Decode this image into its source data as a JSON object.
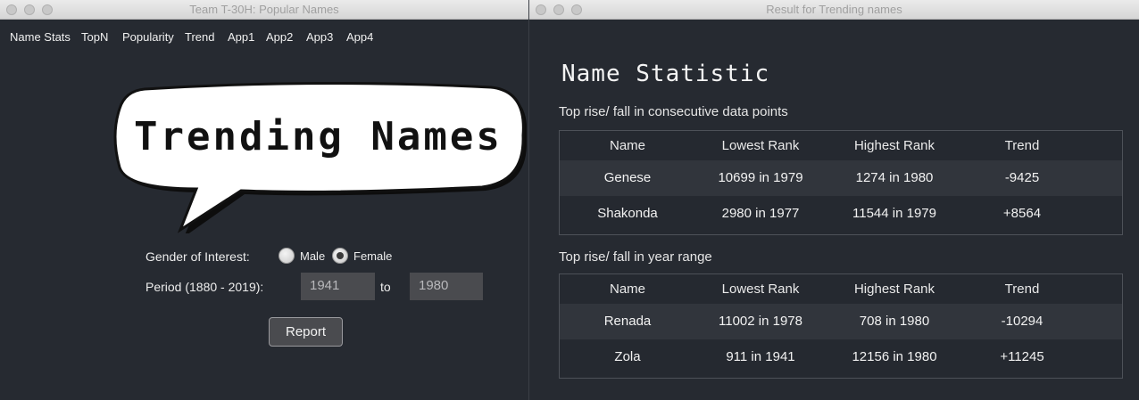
{
  "left_window": {
    "title": "Team T-30H: Popular Names",
    "menu": [
      "Name Stats",
      "TopN",
      "Popularity",
      "Trend",
      "App1",
      "App2",
      "App3",
      "App4"
    ],
    "banner_text": "Trending Names",
    "gender_label": "Gender of Interest:",
    "gender_options": [
      "Male",
      "Female"
    ],
    "gender_selected": "Female",
    "period_label": "Period (1880 - 2019):",
    "period_from": "1941",
    "period_to_label": "to",
    "period_to": "1980",
    "report_button": "Report"
  },
  "right_window": {
    "title": "Result for Trending names",
    "heading": "Name Statistic",
    "consecutive": {
      "label": "Top rise/ fall in consecutive data points",
      "headers": [
        "Name",
        "Lowest Rank",
        "Highest Rank",
        "Trend"
      ],
      "rows": [
        [
          "Genese",
          "10699 in 1979",
          "1274 in 1980",
          "-9425"
        ],
        [
          "Shakonda",
          "2980 in 1977",
          "11544 in 1979",
          "+8564"
        ]
      ]
    },
    "year_range": {
      "label": "Top rise/ fall in year range",
      "headers": [
        "Name",
        "Lowest Rank",
        "Highest Rank",
        "Trend"
      ],
      "rows": [
        [
          "Renada",
          "11002 in 1978",
          "708 in 1980",
          "-10294"
        ],
        [
          "Zola",
          "911 in 1941",
          "12156 in 1980",
          "+11245"
        ]
      ]
    }
  }
}
